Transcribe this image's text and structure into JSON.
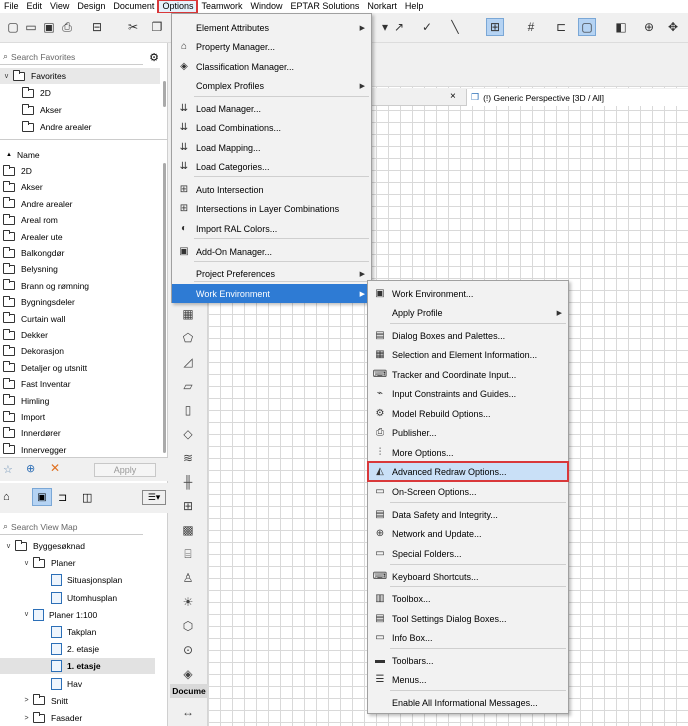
{
  "menubar": {
    "items": [
      "File",
      "Edit",
      "View",
      "Design",
      "Document",
      "Options",
      "Teamwork",
      "Window",
      "EPTAR Solutions",
      "Norkart",
      "Help"
    ],
    "active_index": 5
  },
  "favorites_panel": {
    "search_placeholder": "Search Favorites",
    "root_label": "Favorites",
    "items": [
      "2D",
      "Akser",
      "Andre arealer"
    ]
  },
  "list_panel": {
    "header": "Name",
    "items": [
      "2D",
      "Akser",
      "Andre arealer",
      "Areal rom",
      "Arealer ute",
      "Balkongdør",
      "Belysning",
      "Brann og rømning",
      "Bygningsdeler",
      "Curtain wall",
      "Dekker",
      "Dekorasjon",
      "Detaljer og utsnitt",
      "Fast Inventar",
      "Himling",
      "Import",
      "Innerdører",
      "Innervegger"
    ],
    "apply_label": "Apply"
  },
  "view_map": {
    "search_placeholder": "Search View Map",
    "tree": [
      {
        "label": "Byggesøknad",
        "level": 0,
        "kind": "folder",
        "chevron": "v"
      },
      {
        "label": "Planer",
        "level": 1,
        "kind": "folder",
        "chevron": "v"
      },
      {
        "label": "Situasjonsplan",
        "level": 2,
        "kind": "doc",
        "chevron": ""
      },
      {
        "label": "Utomhusplan",
        "level": 2,
        "kind": "doc",
        "chevron": ""
      },
      {
        "label": "Planer 1:100",
        "level": 1,
        "kind": "docfolder",
        "chevron": "v"
      },
      {
        "label": "Takplan",
        "level": 2,
        "kind": "doc",
        "chevron": ""
      },
      {
        "label": "2. etasje",
        "level": 2,
        "kind": "doc",
        "chevron": ""
      },
      {
        "label": "1. etasje",
        "level": 2,
        "kind": "doc",
        "chevron": "",
        "selected": true
      },
      {
        "label": "Hav",
        "level": 2,
        "kind": "doc",
        "chevron": ""
      },
      {
        "label": "Snitt",
        "level": 1,
        "kind": "folder",
        "chevron": ">"
      },
      {
        "label": "Fasader",
        "level": 1,
        "kind": "folder",
        "chevron": ">"
      }
    ]
  },
  "toolbox": {
    "section_label": "Docume"
  },
  "viewport_tab": {
    "close": "×",
    "label": "(!) Generic Perspective [3D / All]"
  },
  "options_menu": {
    "items": [
      {
        "label": "Element Attributes",
        "icon": "",
        "submenu": true
      },
      {
        "label": "Property Manager...",
        "icon": "tag-icon",
        "submenu": false
      },
      {
        "label": "Classification Manager...",
        "icon": "classification-icon",
        "submenu": false
      },
      {
        "label": "Complex Profiles",
        "icon": "",
        "submenu": true
      },
      {
        "label": "Load Manager...",
        "icon": "load-icon",
        "submenu": false
      },
      {
        "label": "Load Combinations...",
        "icon": "load-icon",
        "submenu": false
      },
      {
        "label": "Load Mapping...",
        "icon": "load-icon",
        "submenu": false
      },
      {
        "label": "Load Categories...",
        "icon": "load-icon",
        "submenu": false
      },
      {
        "label": "Auto Intersection",
        "icon": "intersection-icon",
        "submenu": false
      },
      {
        "label": "Intersections in Layer Combinations",
        "icon": "intersection-icon",
        "submenu": false
      },
      {
        "label": "Import RAL Colors...",
        "icon": "ral-icon",
        "submenu": false
      },
      {
        "label": "Add-On Manager...",
        "icon": "addon-icon",
        "submenu": false
      },
      {
        "label": "Project Preferences",
        "icon": "",
        "submenu": true
      },
      {
        "label": "Work Environment",
        "icon": "",
        "submenu": true,
        "highlighted": true
      }
    ]
  },
  "work_env_menu": {
    "items": [
      {
        "label": "Work Environment...",
        "icon": "work-environment-icon"
      },
      {
        "label": "Apply Profile",
        "icon": "",
        "submenu": true
      },
      {
        "label": "Dialog Boxes and Palettes...",
        "icon": "dialog-icon"
      },
      {
        "label": "Selection and Element Information...",
        "icon": "selection-icon"
      },
      {
        "label": "Tracker and Coordinate Input...",
        "icon": "tracker-icon"
      },
      {
        "label": "Input Constraints and Guides...",
        "icon": "guides-icon"
      },
      {
        "label": "Model Rebuild Options...",
        "icon": "rebuild-icon"
      },
      {
        "label": "Publisher...",
        "icon": "publisher-icon"
      },
      {
        "label": "More Options...",
        "icon": "sliders-icon"
      },
      {
        "label": "Advanced Redraw Options...",
        "icon": "redraw-icon",
        "highlighted": true
      },
      {
        "label": "On-Screen Options...",
        "icon": "onscreen-icon"
      },
      {
        "label": "Data Safety and Integrity...",
        "icon": "data-safety-icon"
      },
      {
        "label": "Network and Update...",
        "icon": "network-icon"
      },
      {
        "label": "Special Folders...",
        "icon": "folder-icon"
      },
      {
        "label": "Keyboard Shortcuts...",
        "icon": "keyboard-icon"
      },
      {
        "label": "Toolbox...",
        "icon": "toolbox-icon"
      },
      {
        "label": "Tool Settings Dialog Boxes...",
        "icon": "tool-settings-icon"
      },
      {
        "label": "Info Box...",
        "icon": "info-box-icon"
      },
      {
        "label": "Toolbars...",
        "icon": "toolbars-icon"
      },
      {
        "label": "Menus...",
        "icon": "menus-icon"
      },
      {
        "label": "Enable All Informational Messages...",
        "icon": ""
      }
    ]
  },
  "colors": {
    "highlight_blue": "#2e7bd4",
    "annotation_red": "#d9383a",
    "menu_bg": "#f2f2f2"
  }
}
